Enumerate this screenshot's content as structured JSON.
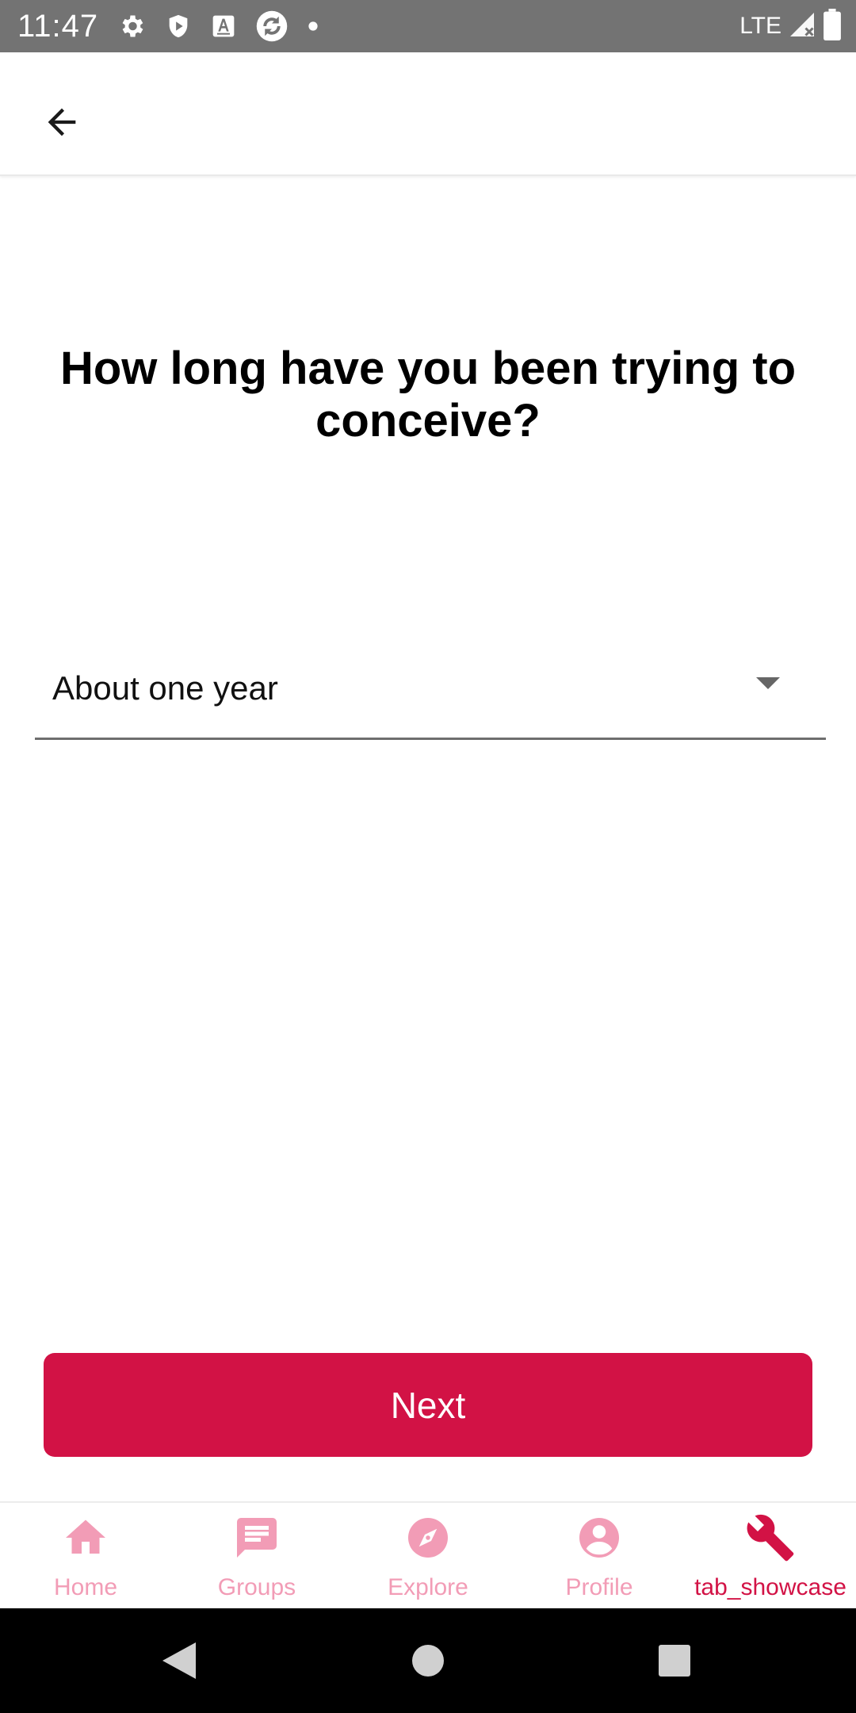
{
  "status_bar": {
    "time": "11:47",
    "network": "LTE",
    "icons": [
      "gear-icon",
      "shield-play-icon",
      "font-a-icon",
      "sync-icon",
      "dot-icon",
      "signal-icon",
      "battery-icon"
    ]
  },
  "app_bar": {
    "back_icon": "arrow-left-icon"
  },
  "question": {
    "title": "How long have you been trying to conceive?"
  },
  "dropdown": {
    "selected_value": "About one year",
    "arrow_icon": "triangle-down-icon"
  },
  "actions": {
    "next_label": "Next"
  },
  "bottom_nav": {
    "items": [
      {
        "label": "Home",
        "icon": "home-icon",
        "active": false
      },
      {
        "label": "Groups",
        "icon": "chat-bubble-icon",
        "active": false
      },
      {
        "label": "Explore",
        "icon": "compass-icon",
        "active": false
      },
      {
        "label": "Profile",
        "icon": "account-circle-icon",
        "active": false
      },
      {
        "label": "tab_showcase",
        "icon": "wrench-icon",
        "active": true
      }
    ]
  },
  "colors": {
    "accent": "#d21245",
    "inactive_tab": "#f29cb6",
    "status_bar": "#737373"
  }
}
